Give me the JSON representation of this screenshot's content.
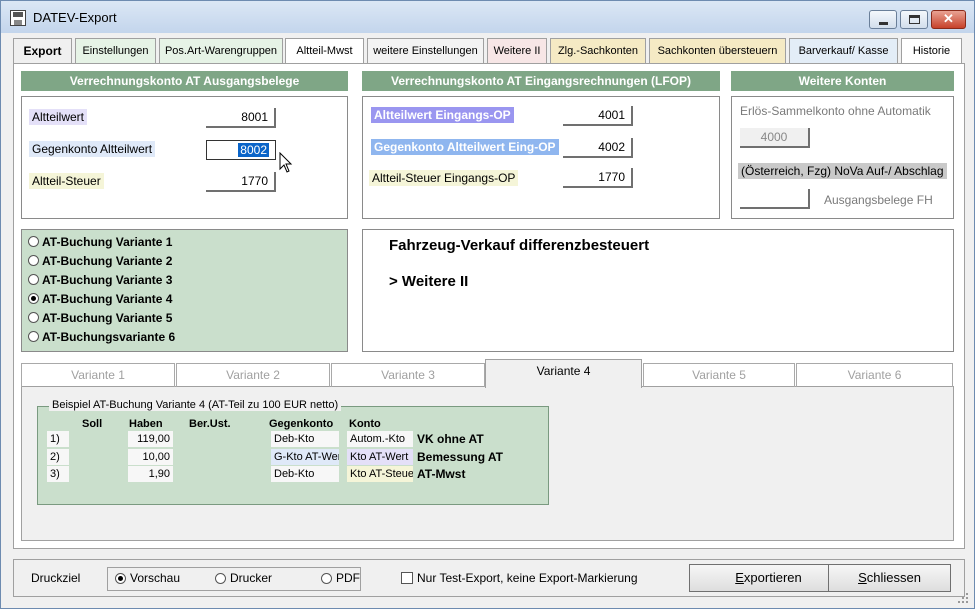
{
  "window": {
    "title": "DATEV-Export",
    "close_glyph": "✕"
  },
  "tabs": [
    {
      "label": "Export"
    },
    {
      "label": "Einstellungen"
    },
    {
      "label": "Pos.Art-Warengruppen"
    },
    {
      "label": "Altteil-Mwst"
    },
    {
      "label": "weitere Einstellungen"
    },
    {
      "label": "Weitere II"
    },
    {
      "label": "Zlg.-Sachkonten"
    },
    {
      "label": "Sachkonten übersteuern"
    },
    {
      "label": "Barverkauf/ Kasse"
    },
    {
      "label": "Historie"
    }
  ],
  "ausgang": {
    "header": "Verrechnungskonto AT Ausgangsbelege",
    "rows": [
      {
        "label": "Altteilwert",
        "value": "8001"
      },
      {
        "label": "Gegenkonto Altteilwert",
        "value": "8002"
      },
      {
        "label": "Altteil-Steuer",
        "value": "1770"
      }
    ]
  },
  "eingang": {
    "header": "Verrechnungskonto AT Eingangsrechnungen (LFOP)",
    "rows": [
      {
        "label": "Altteilwert Eingangs-OP",
        "value": "4001"
      },
      {
        "label": "Gegenkonto Altteilwert Eing-OP",
        "value": "4002"
      },
      {
        "label": "Altteil-Steuer Eingangs-OP",
        "value": "1770"
      }
    ]
  },
  "weitere_konten": {
    "header": "Weitere Konten",
    "erloes_label": "Erlös-Sammelkonto ohne Automatik",
    "erloes_value": "4000",
    "nova_label": "(Österreich, Fzg) NoVa Auf-/ Abschlag",
    "ausgangsbelege_label": "Ausgangsbelege FH",
    "ausgangsbelege_value": ""
  },
  "variants": {
    "options": [
      {
        "label": "AT-Buchung Variante 1"
      },
      {
        "label": "AT-Buchung Variante 2"
      },
      {
        "label": "AT-Buchung Variante 3"
      },
      {
        "label": "AT-Buchung Variante 4"
      },
      {
        "label": "AT-Buchung Variante 5"
      },
      {
        "label": "AT-Buchungsvariante 6"
      }
    ],
    "selected": "AT-Buchung Variante 4"
  },
  "info": {
    "line1": "Fahrzeug-Verkauf differenzbesteuert",
    "line2": "> Weitere II"
  },
  "variant_tabs": [
    {
      "label": "Variante 1"
    },
    {
      "label": "Variante 2"
    },
    {
      "label": "Variante 3"
    },
    {
      "label": "Variante 4"
    },
    {
      "label": "Variante 5"
    },
    {
      "label": "Variante 6"
    }
  ],
  "example": {
    "title": "Beispiel AT-Buchung Variante 4 (AT-Teil zu 100 EUR netto)",
    "columns": {
      "soll": "Soll",
      "haben": "Haben",
      "berust": "Ber.Ust.",
      "gegenkonto": "Gegenkonto",
      "konto": "Konto"
    },
    "rows": [
      {
        "nr": "1)",
        "soll": "",
        "haben": "119,00",
        "berust": "",
        "gegenkonto": "Deb-Kto",
        "konto": "Autom.-Kto",
        "desc": "VK ohne AT"
      },
      {
        "nr": "2)",
        "soll": "",
        "haben": "10,00",
        "berust": "",
        "gegenkonto": "G-Kto AT-Wert",
        "konto": "Kto AT-Wert",
        "desc": "Bemessung AT"
      },
      {
        "nr": "3)",
        "soll": "",
        "haben": "1,90",
        "berust": "",
        "gegenkonto": "Deb-Kto",
        "konto": "Kto AT-Steuer",
        "desc": "AT-Mwst"
      }
    ]
  },
  "bottom": {
    "druckziel_label": "Druckziel",
    "targets": [
      {
        "label": "Vorschau"
      },
      {
        "label": "Drucker"
      },
      {
        "label": "PDF"
      }
    ],
    "selected_target": "Vorschau",
    "test_export_label": "Nur Test-Export, keine Export-Markierung",
    "test_export_checked": false,
    "export_button": {
      "mnemonic": "E",
      "rest": "xportieren"
    },
    "close_button": {
      "mnemonic": "S",
      "rest": "chliessen"
    }
  }
}
